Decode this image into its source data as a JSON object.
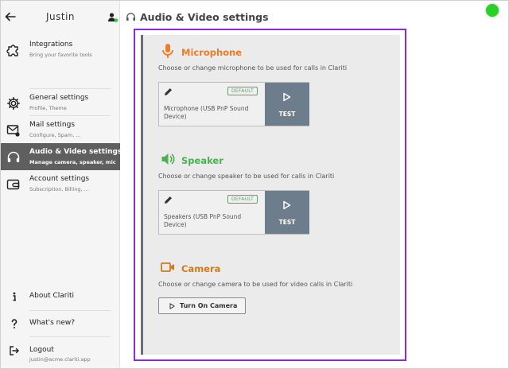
{
  "sidebar": {
    "title": "Justin",
    "items": [
      {
        "label": "Integrations",
        "sub": "Bring your favorite tools"
      },
      {
        "label": "General settings",
        "sub": "Profile, Theme"
      },
      {
        "label": "Mail settings",
        "sub": "Configure, Spam, ..."
      },
      {
        "label": "Audio & Video settings",
        "sub": "Manage camera, speaker, mic"
      },
      {
        "label": "Account settings",
        "sub": "Subscription, Billing, ..."
      }
    ],
    "bottom": [
      {
        "label": "About Clariti"
      },
      {
        "label": "What's new?"
      },
      {
        "label": "Logout",
        "sub": "justin@acme.clariti.app"
      }
    ]
  },
  "page": {
    "title": "Audio & Video settings"
  },
  "microphone": {
    "title": "Microphone",
    "description": "Choose or change microphone to be used for calls in Clariti",
    "badge": "DEFAULT",
    "device": "Microphone (USB PnP Sound Device)",
    "test_label": "TEST"
  },
  "speaker": {
    "title": "Speaker",
    "description": "Choose or change speaker to be used for calls in Clariti",
    "badge": "DEFAULT",
    "device": "Speakers (USB PnP Sound Device)",
    "test_label": "TEST"
  },
  "camera": {
    "title": "Camera",
    "description": "Choose or change camera to be used for video calls in Clariti",
    "button_label": "Turn On Camera"
  },
  "colors": {
    "microphone": "#f07c24",
    "speaker": "#4caf50",
    "camera": "#cf7b1e",
    "highlight": "#8a2be2",
    "active_nav": "#5f5f5f",
    "test_button": "#6d7d8c",
    "status": "#27d227"
  },
  "icons": {
    "back": "arrow-left-icon",
    "user": "user-online-icon",
    "integrations": "puzzle-icon",
    "general": "gear-icon",
    "mail": "mail-settings-icon",
    "audio_video": "headset-icon",
    "account": "wallet-icon",
    "about": "info-icon",
    "whats_new": "question-icon",
    "logout": "logout-icon",
    "microphone": "microphone-icon",
    "speaker": "speaker-icon",
    "camera": "video-camera-icon",
    "edit": "pencil-icon",
    "play": "play-icon"
  }
}
